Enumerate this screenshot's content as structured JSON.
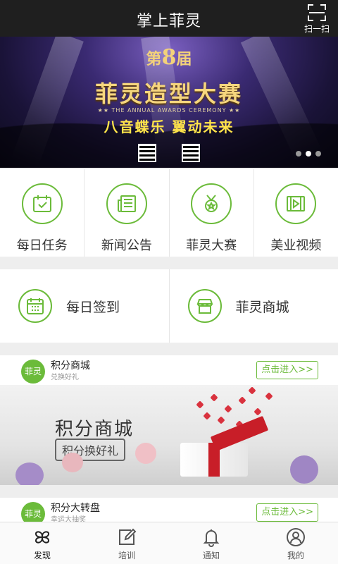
{
  "header": {
    "title": "掌上菲灵",
    "scan_label": "扫一扫"
  },
  "banner": {
    "edition_prefix": "第",
    "edition_number": "8",
    "edition_suffix": "届",
    "contest_name": "菲灵造型大赛",
    "ceremony_text": "★★ THE ANNUAL AWARDS CEREMONY ★★",
    "slogan": "八音蝶乐  翼动未来",
    "dots_count": 3,
    "active_dot": 2
  },
  "quick_menu": [
    {
      "label": "每日任务",
      "icon": "calendar-check-icon"
    },
    {
      "label": "新闻公告",
      "icon": "newspaper-icon"
    },
    {
      "label": "菲灵大赛",
      "icon": "medal-icon"
    },
    {
      "label": "美业视频",
      "icon": "video-icon"
    }
  ],
  "feature_menu": [
    {
      "label": "每日签到",
      "icon": "calendar-grid-icon"
    },
    {
      "label": "菲灵商城",
      "icon": "store-icon"
    }
  ],
  "cards": [
    {
      "badge": "菲灵",
      "title": "积分商城",
      "subtitle": "兑换好礼",
      "button": "点击进入>>",
      "image_title": "积分商城",
      "image_tag": "积分换好礼"
    },
    {
      "badge": "菲灵",
      "title": "积分大转盘",
      "subtitle": "幸运大抽奖",
      "button": "点击进入>>"
    }
  ],
  "bottom_nav": [
    {
      "label": "发现",
      "icon": "clover-icon",
      "active": true
    },
    {
      "label": "培训",
      "icon": "edit-icon",
      "active": false
    },
    {
      "label": "通知",
      "icon": "bell-icon",
      "active": false
    },
    {
      "label": "我的",
      "icon": "user-circle-icon",
      "active": false
    }
  ],
  "colors": {
    "accent": "#6bbb3a",
    "header_bg": "#1f1f1f",
    "page_bg": "#eeeeee"
  }
}
